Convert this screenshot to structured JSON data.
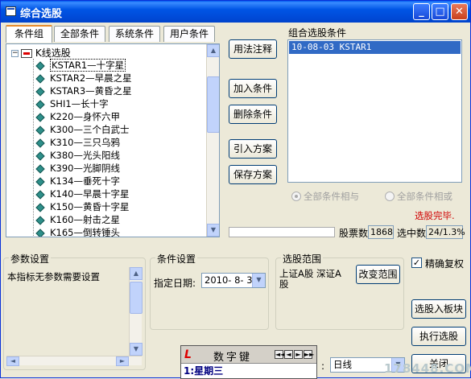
{
  "window": {
    "title": "综合选股",
    "min": "_",
    "max": "□",
    "close": "✕"
  },
  "tabs": [
    "条件组",
    "全部条件",
    "系统条件",
    "用户条件"
  ],
  "tree": {
    "root_label": "K线选股",
    "items": [
      "KSTAR1—十字星",
      "KSTAR2—早晨之星",
      "KSTAR3—黄昏之星",
      "SHI1—长十字",
      "K220—身怀六甲",
      "K300—三个白武士",
      "K310—三只乌鸦",
      "K380—光头阳线",
      "K390—光脚阴线",
      "K134—垂死十字",
      "K140—早晨十字星",
      "K150—黄昏十字星",
      "K160—射击之星",
      "K165—倒转锤头"
    ]
  },
  "middle_buttons": [
    "用法注释",
    "加入条件",
    "删除条件",
    "引入方案",
    "保存方案"
  ],
  "combo_conditions": {
    "label": "组合选股条件",
    "items": [
      "10-08-03 KSTAR1"
    ]
  },
  "radios": [
    "全部条件相与",
    "全部条件相或"
  ],
  "status": {
    "done": "选股完毕.",
    "count_label": "股票数",
    "count_value": "1868",
    "selected_label": "选中数",
    "selected_value": "24/1.3%",
    "done_color": "#d00000"
  },
  "param_group": {
    "legend": "参数设置",
    "text": "本指标无参数需要设置"
  },
  "condition_group": {
    "legend": "条件设置",
    "date_label": "指定日期:",
    "date_value": "2010- 8- 3"
  },
  "range_group": {
    "legend": "选股范围",
    "scope": "上证A股 深证A股",
    "change_button": "改变范围"
  },
  "period": {
    "value": "日线"
  },
  "right_buttons": {
    "check_label": "精确复权",
    "check_mark": "✓",
    "sector_button": "选股入板块",
    "run_button": "执行选股",
    "close_button": "关闭"
  },
  "keyboard_genie": {
    "logo": "L",
    "title": "数字键",
    "input": "1:星期三",
    "nav": [
      "◄◄",
      "◄",
      "►",
      "►►"
    ]
  },
  "watermark": "178448.COM"
}
